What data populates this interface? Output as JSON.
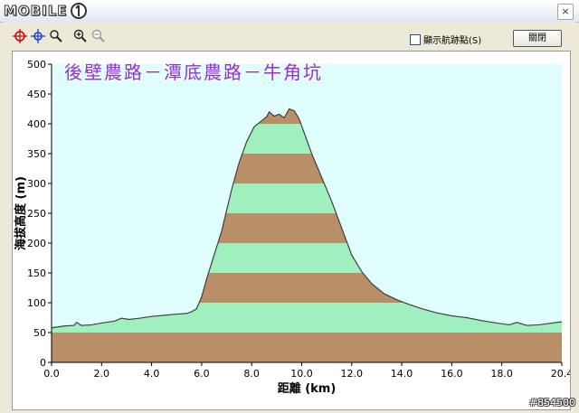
{
  "app": {
    "logo_text": "MOBILE",
    "close_glyph": "×"
  },
  "toolbar": {
    "tools": [
      "locate-target-icon",
      "crosshair-icon",
      "zoom-reset-icon",
      "zoom-in-icon",
      "zoom-out-icon"
    ],
    "show_track_label": "顯示航跡點(S)",
    "show_track_checked": false,
    "close_label": "關閉"
  },
  "chart_data": {
    "type": "area",
    "title": "後壁農路－潭底農路－牛角坑",
    "xlabel": "距離 (km)",
    "ylabel": "海拔高度 (m)",
    "xlim": [
      0,
      20.4
    ],
    "ylim": [
      0,
      500
    ],
    "x_ticks": [
      "0.0",
      "2.0",
      "4.0",
      "6.0",
      "8.0",
      "10.0",
      "12.0",
      "14.0",
      "16.0",
      "18.0",
      "20.4"
    ],
    "y_ticks": [
      "0",
      "50",
      "100",
      "150",
      "200",
      "250",
      "300",
      "350",
      "400",
      "450",
      "500"
    ],
    "band_step": 50,
    "colors": {
      "background": "#e0fefe",
      "band_light": "#9ff0be",
      "band_dark": "#b98f68",
      "line": "#404040",
      "title": "#9a2fd1"
    },
    "series": [
      {
        "points": [
          [
            0,
            58
          ],
          [
            0.5,
            61
          ],
          [
            0.9,
            62
          ],
          [
            1.0,
            67
          ],
          [
            1.2,
            62
          ],
          [
            1.6,
            63
          ],
          [
            2.0,
            66
          ],
          [
            2.5,
            69
          ],
          [
            2.8,
            74
          ],
          [
            3.1,
            72
          ],
          [
            3.5,
            74
          ],
          [
            4.0,
            77
          ],
          [
            4.5,
            79
          ],
          [
            5.0,
            81
          ],
          [
            5.4,
            82
          ],
          [
            5.6,
            85
          ],
          [
            5.8,
            90
          ],
          [
            6.0,
            110
          ],
          [
            6.2,
            140
          ],
          [
            6.5,
            180
          ],
          [
            6.8,
            220
          ],
          [
            7.0,
            255
          ],
          [
            7.2,
            290
          ],
          [
            7.5,
            335
          ],
          [
            7.8,
            370
          ],
          [
            8.1,
            395
          ],
          [
            8.4,
            405
          ],
          [
            8.6,
            412
          ],
          [
            8.7,
            420
          ],
          [
            8.9,
            413
          ],
          [
            9.1,
            416
          ],
          [
            9.3,
            410
          ],
          [
            9.5,
            425
          ],
          [
            9.7,
            422
          ],
          [
            9.9,
            408
          ],
          [
            10.1,
            385
          ],
          [
            10.4,
            350
          ],
          [
            10.8,
            310
          ],
          [
            11.2,
            270
          ],
          [
            11.6,
            225
          ],
          [
            12.0,
            180
          ],
          [
            12.4,
            152
          ],
          [
            12.8,
            132
          ],
          [
            13.3,
            115
          ],
          [
            13.8,
            105
          ],
          [
            14.3,
            97
          ],
          [
            14.8,
            90
          ],
          [
            15.4,
            83
          ],
          [
            16.0,
            78
          ],
          [
            16.6,
            75
          ],
          [
            17.2,
            70
          ],
          [
            17.8,
            66
          ],
          [
            18.3,
            63
          ],
          [
            18.6,
            67
          ],
          [
            19.0,
            62
          ],
          [
            19.5,
            63
          ],
          [
            20.0,
            66
          ],
          [
            20.4,
            68
          ]
        ]
      }
    ]
  },
  "watermark": "#854500"
}
